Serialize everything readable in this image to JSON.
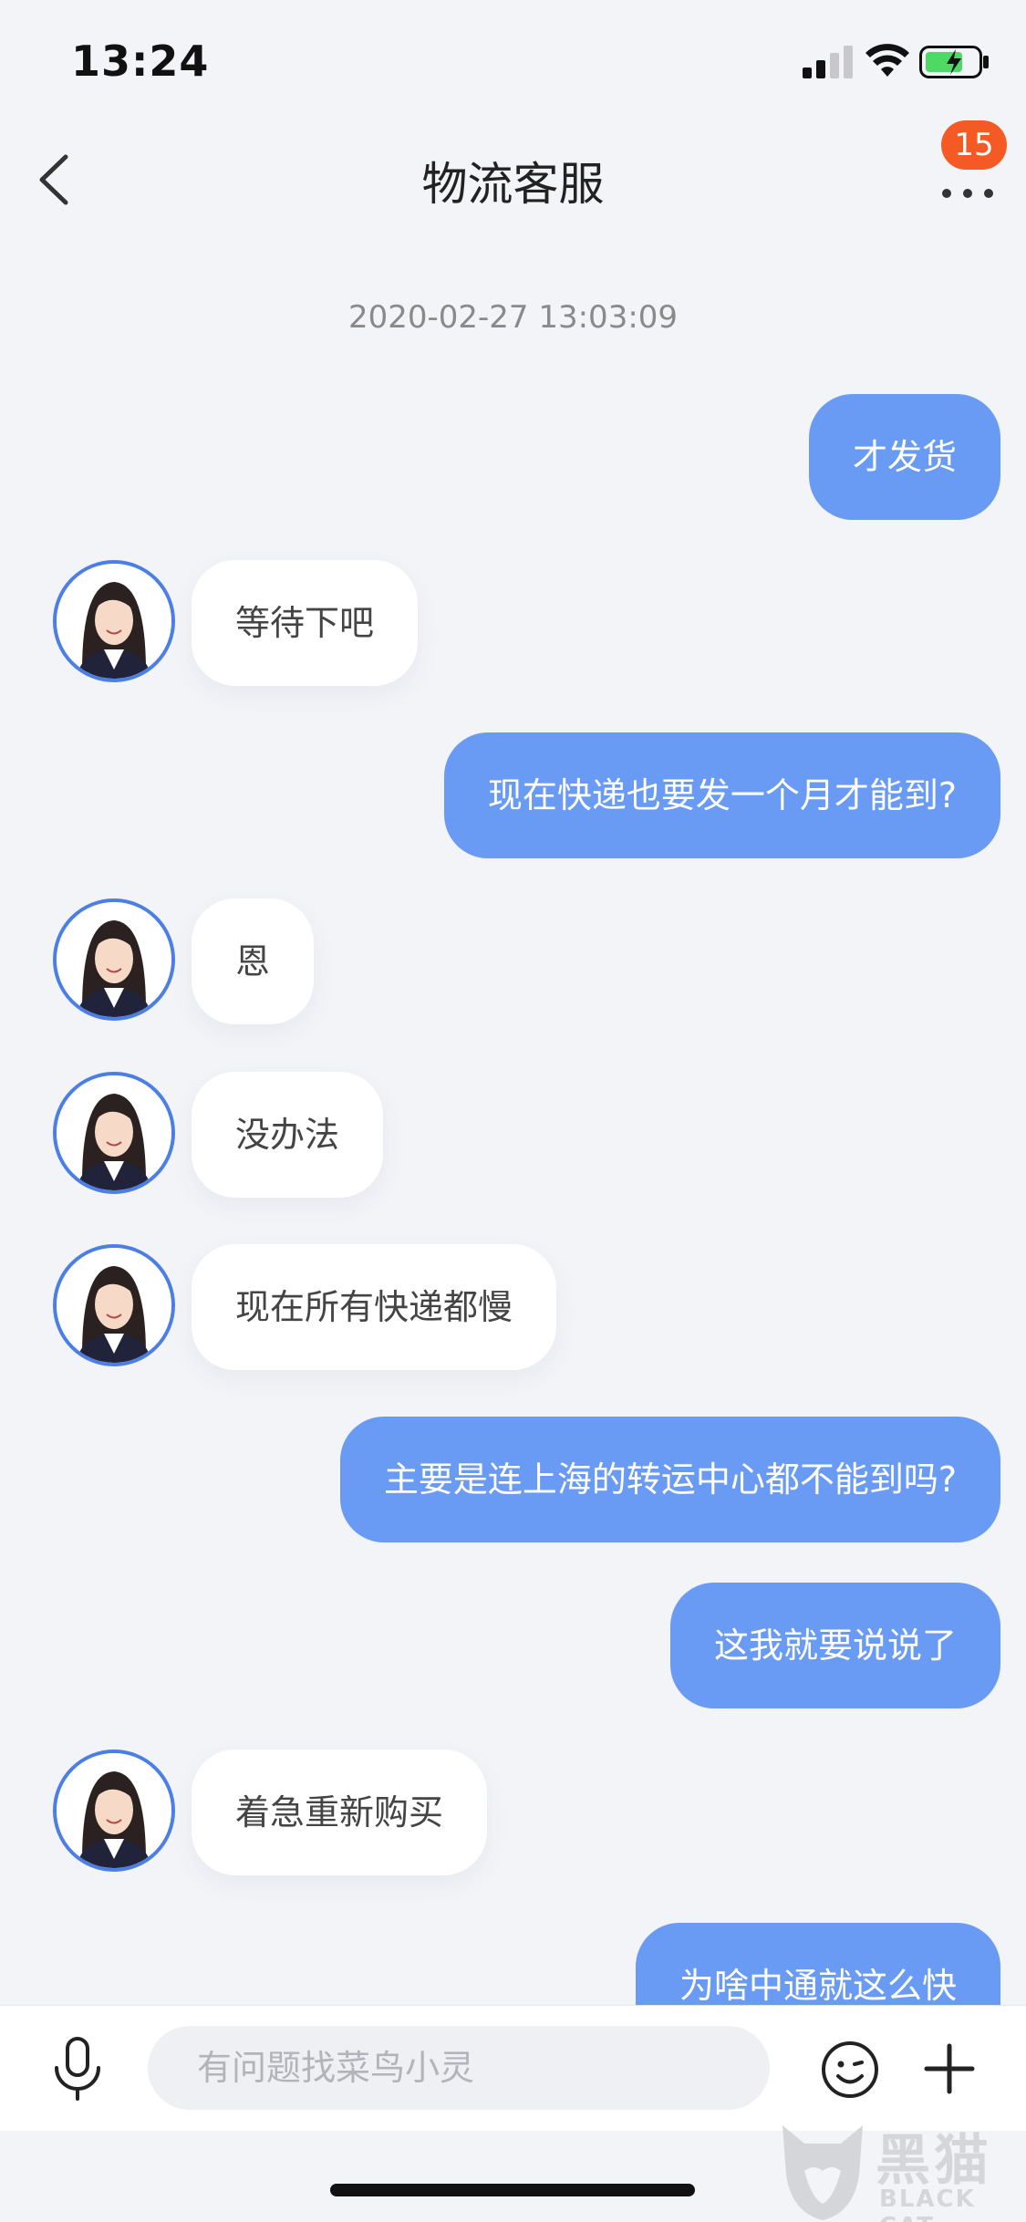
{
  "status_bar": {
    "time": "13:24"
  },
  "nav": {
    "title": "物流客服",
    "badge_count": "15"
  },
  "timestamp": "2020-02-27 13:03:09",
  "messages": [
    {
      "from": "me",
      "text": "才发货"
    },
    {
      "from": "agent",
      "text": "等待下吧"
    },
    {
      "from": "me",
      "text": "现在快递也要发一个月才能到?"
    },
    {
      "from": "agent",
      "text": "恩"
    },
    {
      "from": "agent",
      "text": "没办法"
    },
    {
      "from": "agent",
      "text": "现在所有快递都慢"
    },
    {
      "from": "me",
      "text": "主要是连上海的转运中心都不能到吗?"
    },
    {
      "from": "me",
      "text": "这我就要说说了"
    },
    {
      "from": "agent",
      "text": "着急重新购买"
    },
    {
      "from": "me",
      "text": "为啥中通就这么快"
    }
  ],
  "input": {
    "placeholder": "有问题找菜鸟小灵"
  },
  "watermark": {
    "cn": "黑猫",
    "en": "BLACK CAT"
  },
  "colors": {
    "my_bubble": "#6a9bf4",
    "agent_bubble": "#ffffff",
    "badge": "#f55a24",
    "background": "#f3f4f8"
  },
  "icons": [
    "back-icon",
    "more-icon",
    "mic-icon",
    "emoji-icon",
    "plus-icon",
    "signal-icon",
    "wifi-icon",
    "battery-icon"
  ]
}
